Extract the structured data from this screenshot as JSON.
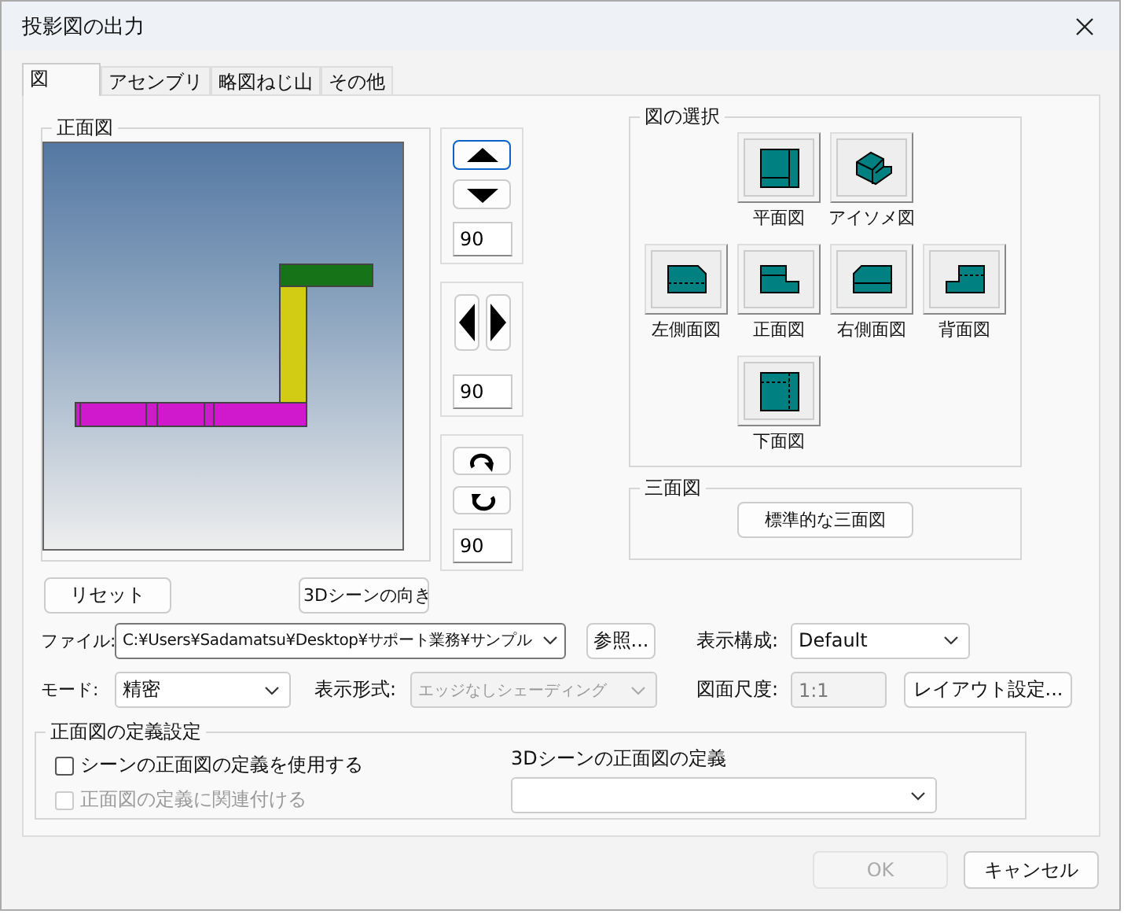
{
  "window": {
    "title": "投影図の出力"
  },
  "tabs": [
    {
      "label": "図",
      "selected": true
    },
    {
      "label": "アセンブリ",
      "selected": false
    },
    {
      "label": "略図ねじ山",
      "selected": false
    },
    {
      "label": "その他",
      "selected": false
    }
  ],
  "front_view": {
    "title": "正面図"
  },
  "rotation_controls": [
    {
      "kind": "vertical",
      "value": "90"
    },
    {
      "kind": "horizontal",
      "value": "90"
    },
    {
      "kind": "rotate",
      "value": "90"
    }
  ],
  "view_selection": {
    "title": "図の選択",
    "views": [
      {
        "kind": "top",
        "label": "平面図"
      },
      {
        "kind": "iso",
        "label": "アイソメ図"
      },
      {
        "kind": "left",
        "label": "左側面図"
      },
      {
        "kind": "front",
        "label": "正面図"
      },
      {
        "kind": "right",
        "label": "右側面図"
      },
      {
        "kind": "back",
        "label": "背面図"
      },
      {
        "kind": "bottom",
        "label": "下面図"
      }
    ]
  },
  "three_view": {
    "title": "三面図",
    "button": "標準的な三面図"
  },
  "reset_button": "リセット",
  "scene_orientation_button": "3Dシーンの向き",
  "file": {
    "label": "ファイル:",
    "value": "C:¥Users¥Sadamatsu¥Desktop¥サポート業務¥サンプル"
  },
  "browse_button": "参照...",
  "display_config": {
    "label": "表示構成:",
    "value": "Default"
  },
  "mode": {
    "label": "モード:",
    "value": "精密"
  },
  "display_format": {
    "label": "表示形式:",
    "value": "エッジなしシェーディング",
    "disabled": true
  },
  "scale": {
    "label": "図面尺度:",
    "value": "1:1",
    "disabled": true
  },
  "layout_button": "レイアウト設定...",
  "definition_group": {
    "title": "正面図の定義設定",
    "checkboxes": [
      {
        "label": "シーンの正面図の定義を使用する",
        "checked": false,
        "disabled": false
      },
      {
        "label": "正面図の定義に関連付ける",
        "checked": false,
        "disabled": true
      }
    ],
    "scene_definition_label": "3Dシーンの正面図の定義"
  },
  "buttons": [
    {
      "label": "OK",
      "disabled": true
    },
    {
      "label": "キャンセル",
      "disabled": false
    }
  ]
}
